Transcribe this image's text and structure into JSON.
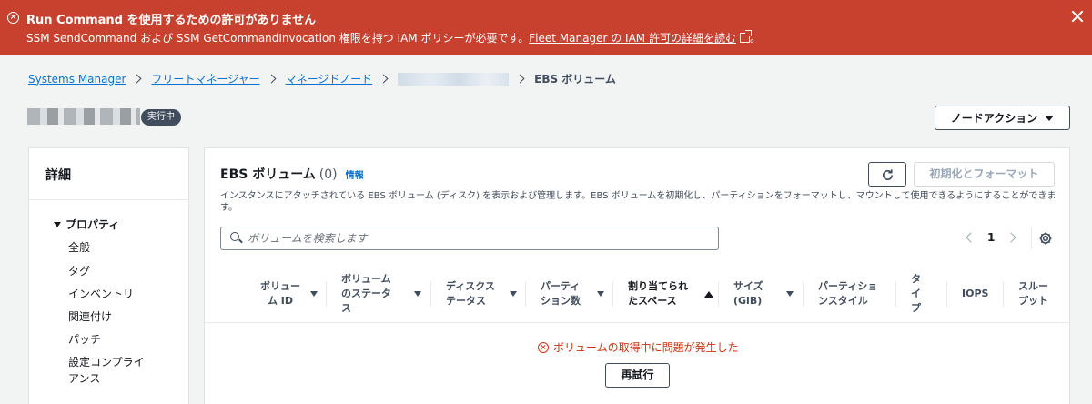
{
  "banner": {
    "title": "Run Command を使用するための許可がありません",
    "message_prefix": "SSM SendCommand および SSM GetCommandInvocation 権限を持つ IAM ポリシーが必要です。",
    "link_text": "Fleet Manager の IAM 許可の詳細を読む",
    "message_suffix": "。",
    "icon": "error-circle-icon",
    "bg_color": "#c8412f"
  },
  "breadcrumb": {
    "items": [
      "Systems Manager",
      "フリートマネージャー",
      "マネージドノード"
    ],
    "current": "EBS ボリューム"
  },
  "node": {
    "status": "実行中",
    "action_label": "ノードアクション"
  },
  "details": {
    "title": "詳細",
    "group_label": "プロパティ",
    "items": [
      "全般",
      "タグ",
      "インベントリ",
      "関連付け",
      "パッチ",
      "設定コンプライアンス"
    ]
  },
  "ebs": {
    "title": "EBS ボリューム",
    "count": "(0)",
    "info_label": "情報",
    "init_label": "初期化とフォーマット",
    "description": "インスタンスにアタッチされている EBS ボリューム (ディスク) を表示および管理します。EBS ボリュームを初期化し、パーティションをフォーマットし、マウントして使用できるようにすることができます。",
    "search_placeholder": "ボリュームを検索します",
    "page": "1",
    "columns": [
      "ボリューム ID",
      "ボリュームのステータス",
      "ディスクステータス",
      "パーティション数",
      "割り当てられたスペース",
      "サイズ (GiB)",
      "パーティションスタイル",
      "タイプ",
      "IOPS",
      "スループット"
    ],
    "error_message": "ボリュームの取得中に問題が発生した",
    "retry_label": "再試行",
    "error_color": "#d13212"
  }
}
